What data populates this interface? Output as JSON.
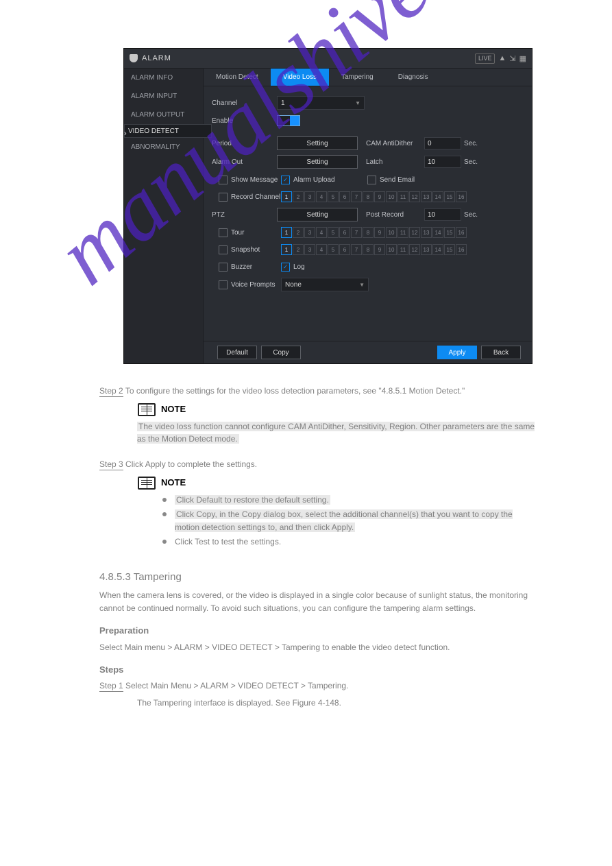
{
  "shot": {
    "title": "ALARM",
    "header": {
      "live": "LIVE"
    },
    "side": [
      "ALARM INFO",
      "ALARM INPUT",
      "ALARM OUTPUT",
      "VIDEO DETECT",
      "ABNORMALITY"
    ],
    "tabs": [
      "Motion Detect",
      "Video Loss",
      "Tampering",
      "Diagnosis"
    ],
    "labels": {
      "channel": "Channel",
      "enable": "Enable",
      "period": "Period",
      "camAnti": "CAM AntiDither",
      "alarmOut": "Alarm Out",
      "latch": "Latch",
      "showMsg": "Show Message",
      "alarmUpload": "Alarm Upload",
      "sendEmail": "Send Email",
      "recordCh": "Record Channel",
      "ptz": "PTZ",
      "postRecord": "Post Record",
      "tour": "Tour",
      "snapshot": "Snapshot",
      "buzzer": "Buzzer",
      "log": "Log",
      "voice": "Voice Prompts",
      "sec": "Sec."
    },
    "values": {
      "channel": "1",
      "camAnti": "0",
      "latch": "10",
      "postRecord": "10",
      "voice": "None"
    },
    "buttons": {
      "setting": "Setting",
      "default": "Default",
      "copy": "Copy",
      "apply": "Apply",
      "back": "Back"
    },
    "channels": {
      "count": 16,
      "selected": [
        1
      ]
    }
  },
  "doc": {
    "noteWord": "NOTE",
    "step2": {
      "u": "Step 2",
      "rest": "  To configure the settings for the video loss detection parameters, see \"4.8.5.1 Motion Detect.\""
    },
    "note1": "The video loss function cannot configure CAM AntiDither, Sensitivity, Region. Other parameters are the same as the Motion Detect mode.",
    "step3": {
      "u": "Step 3",
      "rest": "  Click Apply to complete the settings."
    },
    "note2": [
      "Click Default to restore the default setting.",
      "Click Copy, in the Copy dialog box, select the additional channel(s) that you want to copy the motion detection settings to, and then click Apply.",
      "Click Test to test the settings."
    ],
    "h_tamper": "4.8.5.3 Tampering",
    "tamper_desc": "When the camera lens is covered, or the video is displayed in a single color because of sunlight status, the monitoring cannot be continued normally. To avoid such situations, you can configure the tampering alarm settings.",
    "h_prep": "Preparation",
    "prep": "Select Main menu > ALARM > VIDEO DETECT > Tampering to enable the video detect function.",
    "h_steps": "Steps",
    "step1": {
      "u": "Step 1",
      "rest": "  Select Main Menu > ALARM > VIDEO DETECT > Tampering."
    },
    "step1_result": "The Tampering interface is displayed. See Figure 4-148."
  }
}
